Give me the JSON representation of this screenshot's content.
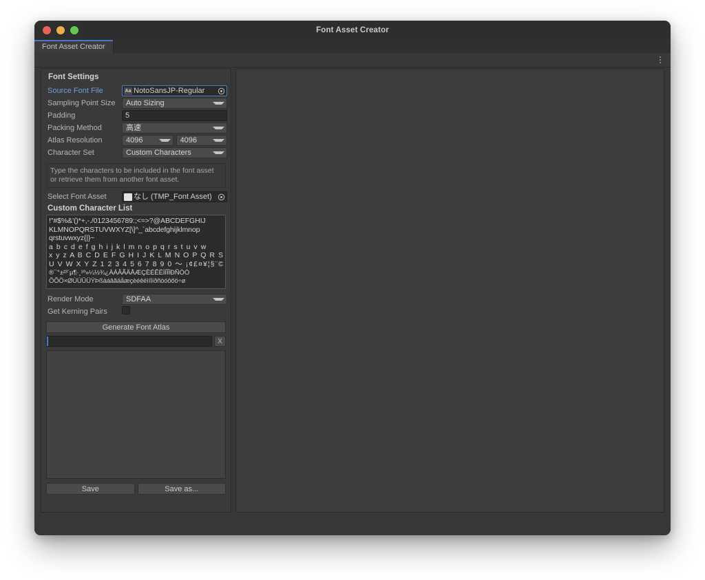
{
  "window": {
    "title": "Font Asset Creator",
    "traffic_lights": [
      "close-red",
      "minimize-yellow",
      "zoom-green"
    ]
  },
  "tab": {
    "label": "Font Asset Creator"
  },
  "toolbar": {
    "menu_icon": "kebab-menu-icon"
  },
  "font_settings": {
    "header": "Font Settings",
    "source_font_file": {
      "label": "Source Font File",
      "value": "NotoSansJP-Regular",
      "icon": "font-asset-icon",
      "picker_icon": "object-picker-icon"
    },
    "sampling_point_size": {
      "label": "Sampling Point Size",
      "value": "Auto Sizing"
    },
    "padding": {
      "label": "Padding",
      "value": "5"
    },
    "packing_method": {
      "label": "Packing Method",
      "value": "高速"
    },
    "atlas_resolution": {
      "label": "Atlas Resolution",
      "width": "4096",
      "height": "4096"
    },
    "character_set": {
      "label": "Character Set",
      "value": "Custom Characters"
    },
    "info_text": "Type the characters to be included in the font asset or retrieve them from another font asset.",
    "select_font_asset": {
      "label": "Select Font Asset",
      "value": "なし (TMP_Font Asset)",
      "icon": "asset-document-icon",
      "picker_icon": "object-picker-icon"
    },
    "custom_character_list": {
      "header": "Custom Character List",
      "lines": [
        "!\"#$%&'()*+,-./0123456789:;<=>?@ABCDEFGHIJ",
        "KLMNOPQRSTUVWXYZ[\\]^_`abcdefghijklmnop",
        "qrstuvwxyz{|}~",
        "a b c d e f g h i j k l m n o p q r s t u v w",
        "x y z A B C D E F G H I J K L M N O P Q R S T",
        "U V W X Y Z 1 2 3 4 5 6 7 8 9 0 ～ ¡¢£¤¥¦§¨©ª«¬",
        "®¯°±²³´µ¶·¸¹º»¼½¾¿ÀÁÂÃÄÅÆÇÈÉÊËÌÍÎÏÐÑÒÓ",
        "ÔÕÖ×ØÙÚÛÜÝÞßàáâãäåæçèéêëìíîïðñòóôõö÷ø"
      ]
    },
    "render_mode": {
      "label": "Render Mode",
      "value": "SDFAA"
    },
    "get_kerning_pairs": {
      "label": "Get Kerning Pairs",
      "checked": false
    },
    "generate_button": "Generate Font Atlas",
    "progress": {
      "value": "",
      "clear_label": "X"
    },
    "save_button": "Save",
    "save_as_button": "Save as..."
  },
  "colors": {
    "accent_blue": "#4b77c9",
    "label_active": "#6f9ddb",
    "panel_bg": "#3a3a3a",
    "editor_bg": "#383838",
    "field_bg": "#2a2a2a",
    "popup_bg": "#4a4a4a",
    "text": "#d2d2d2",
    "label_text": "#b6b6b6"
  }
}
